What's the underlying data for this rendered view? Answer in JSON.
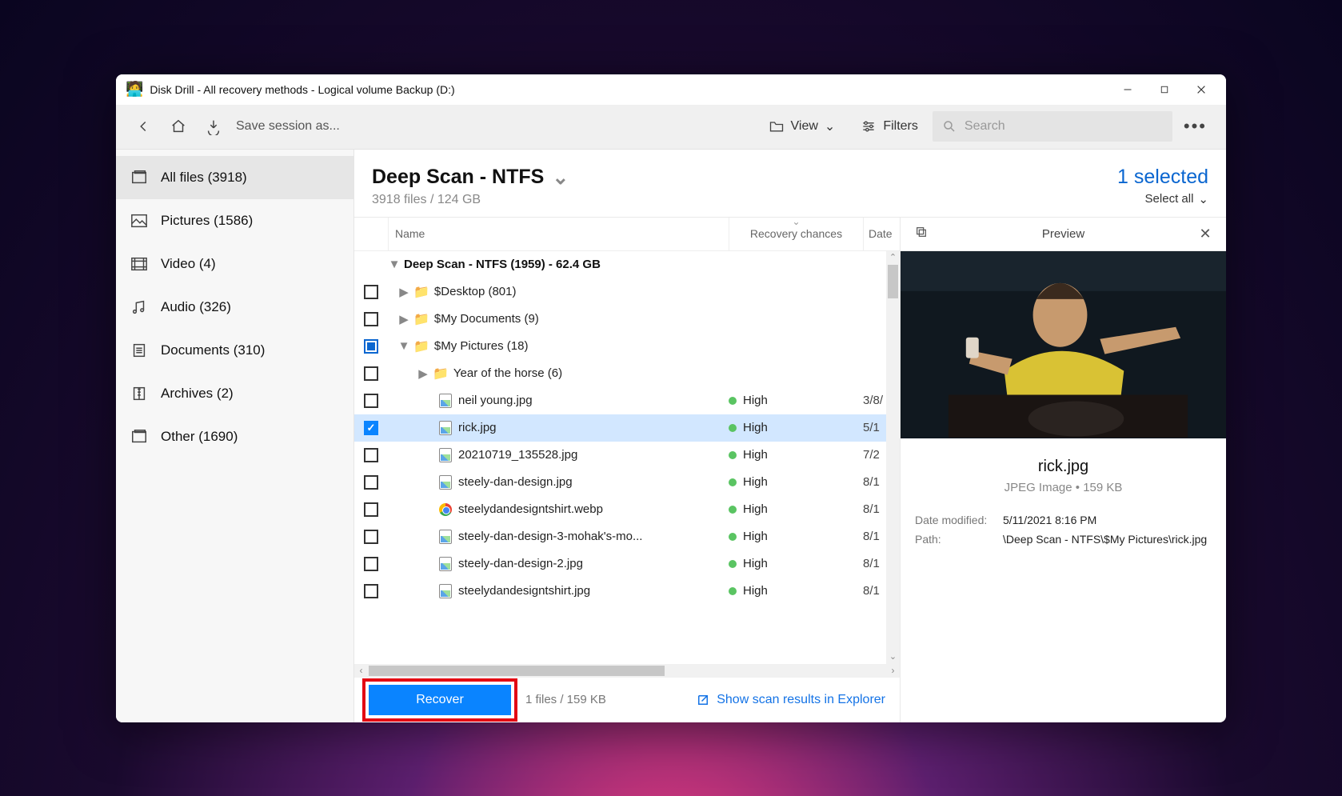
{
  "window": {
    "title": "Disk Drill - All recovery methods - Logical volume Backup (D:)"
  },
  "toolbar": {
    "save_session": "Save session as...",
    "view_label": "View",
    "filters_label": "Filters",
    "search_placeholder": "Search"
  },
  "sidebar": {
    "items": [
      {
        "label": "All files (3918)"
      },
      {
        "label": "Pictures (1586)"
      },
      {
        "label": "Video (4)"
      },
      {
        "label": "Audio (326)"
      },
      {
        "label": "Documents (310)"
      },
      {
        "label": "Archives (2)"
      },
      {
        "label": "Other (1690)"
      }
    ]
  },
  "main_header": {
    "title": "Deep Scan - NTFS",
    "subtitle": "3918 files / 124 GB",
    "selected_text": "1 selected",
    "select_all": "Select all"
  },
  "columns": {
    "name": "Name",
    "recovery": "Recovery chances",
    "date": "Date"
  },
  "group": {
    "label": "Deep Scan - NTFS (1959) - 62.4 GB"
  },
  "rows": [
    {
      "type": "folder",
      "indent": 0,
      "tw": "right",
      "name": "$Desktop (801)"
    },
    {
      "type": "folder",
      "indent": 0,
      "tw": "right",
      "name": "$My Documents (9)"
    },
    {
      "type": "folder",
      "indent": 0,
      "tw": "down",
      "name": "$My Pictures (18)",
      "chk": "indet"
    },
    {
      "type": "folder",
      "indent": 1,
      "tw": "right",
      "name": "Year of the horse (6)"
    },
    {
      "type": "file",
      "indent": 1,
      "icon": "img",
      "name": "neil young.jpg",
      "rec": "High",
      "date": "3/8/"
    },
    {
      "type": "file",
      "indent": 1,
      "icon": "img",
      "name": "rick.jpg",
      "rec": "High",
      "date": "5/1",
      "chk": "checked",
      "selected": true
    },
    {
      "type": "file",
      "indent": 1,
      "icon": "img",
      "name": "20210719_135528.jpg",
      "rec": "High",
      "date": "7/2"
    },
    {
      "type": "file",
      "indent": 1,
      "icon": "img",
      "name": "steely-dan-design.jpg",
      "rec": "High",
      "date": "8/1"
    },
    {
      "type": "file",
      "indent": 1,
      "icon": "chrome",
      "name": "steelydandesigntshirt.webp",
      "rec": "High",
      "date": "8/1"
    },
    {
      "type": "file",
      "indent": 1,
      "icon": "img",
      "name": "steely-dan-design-3-mohak's-mo...",
      "rec": "High",
      "date": "8/1"
    },
    {
      "type": "file",
      "indent": 1,
      "icon": "img",
      "name": "steely-dan-design-2.jpg",
      "rec": "High",
      "date": "8/1"
    },
    {
      "type": "file",
      "indent": 1,
      "icon": "img",
      "name": "steelydandesigntshirt.jpg",
      "rec": "High",
      "date": "8/1"
    }
  ],
  "footer": {
    "recover": "Recover",
    "info": "1 files / 159 KB",
    "link": "Show scan results in Explorer"
  },
  "preview": {
    "title": "Preview",
    "filename": "rick.jpg",
    "meta": "JPEG Image • 159 KB",
    "kv": [
      {
        "k": "Date modified:",
        "v": "5/11/2021 8:16 PM"
      },
      {
        "k": "Path:",
        "v": "\\Deep Scan - NTFS\\$My Pictures\\rick.jpg"
      }
    ]
  }
}
